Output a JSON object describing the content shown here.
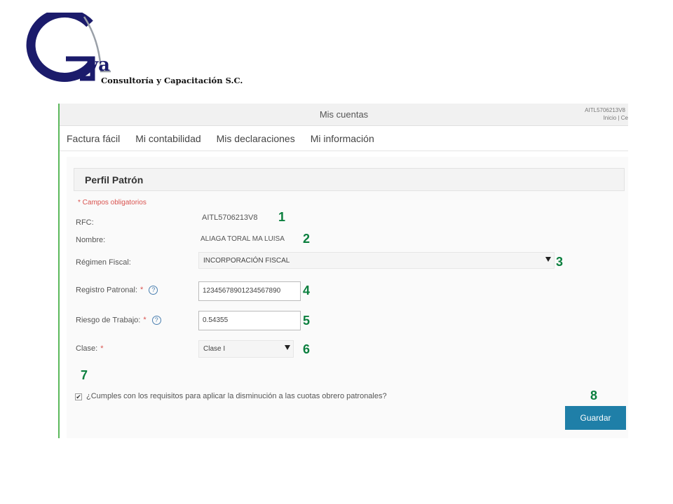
{
  "logo": {
    "mark": "va",
    "caption": "Consultoría y Capacitación S.C.",
    "colors": {
      "primary": "#1b1b6b",
      "accent": "#9aa0a8"
    }
  },
  "topbar": {
    "title": "Mis cuentas",
    "rfc": "AITL5706213V8",
    "links": "Inicio | Ce"
  },
  "nav": {
    "items": [
      "Factura fácil",
      "Mi contabilidad",
      "Mis declaraciones",
      "Mi información"
    ]
  },
  "form": {
    "title": "Perfil Patrón",
    "required_note": "* Campos obligatorios",
    "rfc_label": "RFC:",
    "rfc_value": "AITL5706213V8",
    "nombre_label": "Nombre:",
    "nombre_value": "ALIAGA TORAL MA LUISA",
    "regimen_label": "Régimen Fiscal:",
    "regimen_value": "INCORPORACIÓN FISCAL",
    "registro_label": "Registro Patronal:",
    "registro_value": "12345678901234567890",
    "riesgo_label": "Riesgo de Trabajo:",
    "riesgo_value": "0.54355",
    "clase_label": "Clase:",
    "clase_value": "Clase I",
    "required_mark": "*",
    "help_glyph": "?",
    "checkbox_checked": true,
    "checkbox_glyph": "✔",
    "checkbox_label": "¿Cumples con los requisitos para aplicar la disminución a las cuotas obrero patronales?",
    "save_label": "Guardar"
  },
  "callouts": [
    "1",
    "2",
    "3",
    "4",
    "5",
    "6",
    "7",
    "8"
  ],
  "colors": {
    "accent_green": "#5cb85c",
    "button_blue": "#1f7fa8",
    "callout_green": "#0b7f3e",
    "required_red": "#d9534f"
  }
}
